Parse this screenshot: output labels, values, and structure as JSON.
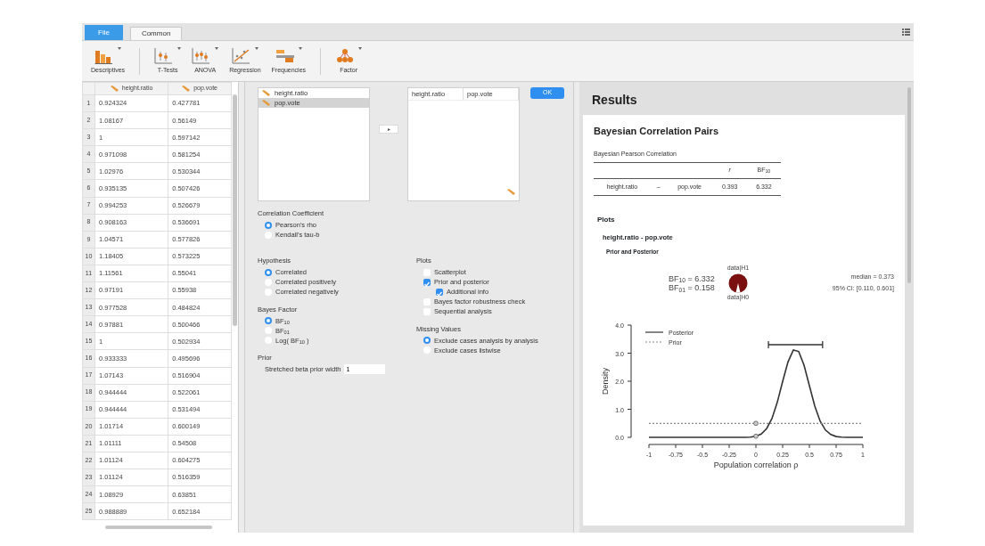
{
  "menu_tabs": [
    {
      "label": "File",
      "kind": "file",
      "selected": false
    },
    {
      "label": "Common",
      "kind": "tab",
      "selected": true
    }
  ],
  "toolbar": [
    {
      "label": "Descriptives",
      "kind": "bars"
    },
    {
      "label": "T-Tests",
      "kind": "ttest"
    },
    {
      "label": "ANOVA",
      "kind": "anova"
    },
    {
      "label": "Regression",
      "kind": "regression"
    },
    {
      "label": "Frequencies",
      "kind": "frequencies"
    },
    {
      "label": "Factor",
      "kind": "factor"
    }
  ],
  "data_table": {
    "columns": [
      "",
      "height.ratio",
      "pop.vote"
    ],
    "rows": [
      [
        "1",
        "0.924324",
        "0.427781"
      ],
      [
        "2",
        "1.08167",
        "0.56149"
      ],
      [
        "3",
        "1",
        "0.597142"
      ],
      [
        "4",
        "0.971098",
        "0.581254"
      ],
      [
        "5",
        "1.02976",
        "0.530344"
      ],
      [
        "6",
        "0.935135",
        "0.507426"
      ],
      [
        "7",
        "0.994253",
        "0.526679"
      ],
      [
        "8",
        "0.908163",
        "0.536691"
      ],
      [
        "9",
        "1.04571",
        "0.577826"
      ],
      [
        "10",
        "1.18405",
        "0.573225"
      ],
      [
        "11",
        "1.11561",
        "0.55041"
      ],
      [
        "12",
        "0.97191",
        "0.55938"
      ],
      [
        "13",
        "0.977528",
        "0.484824"
      ],
      [
        "14",
        "0.97881",
        "0.500466"
      ],
      [
        "15",
        "1",
        "0.502934"
      ],
      [
        "16",
        "0.933333",
        "0.495696"
      ],
      [
        "17",
        "1.07143",
        "0.516904"
      ],
      [
        "18",
        "0.944444",
        "0.522061"
      ],
      [
        "19",
        "0.944444",
        "0.531494"
      ],
      [
        "20",
        "1.01714",
        "0.600149"
      ],
      [
        "21",
        "1.01111",
        "0.54508"
      ],
      [
        "22",
        "1.01124",
        "0.604275"
      ],
      [
        "23",
        "1.01124",
        "0.516359"
      ],
      [
        "24",
        "1.08929",
        "0.63851"
      ],
      [
        "25",
        "0.988889",
        "0.652184"
      ]
    ]
  },
  "analysis": {
    "available_variables": [
      {
        "label": "height.ratio",
        "selected": false
      },
      {
        "label": "pop.vote",
        "selected": true
      }
    ],
    "move_button": "▸",
    "selected_variables": [
      "height.ratio",
      "pop.vote"
    ],
    "ok_button": "OK",
    "correlation_coefficient": {
      "title": "Correlation Coefficient",
      "kind": "radio",
      "options": [
        {
          "label": "Pearson's rho",
          "selected": true
        },
        {
          "label": "Kendall's tau-b",
          "selected": false
        }
      ]
    },
    "left_groups": [
      {
        "title": "Hypothesis",
        "kind": "radio",
        "options": [
          {
            "label": "Correlated",
            "selected": true
          },
          {
            "label": "Correlated positively",
            "selected": false
          },
          {
            "label": "Correlated negatively",
            "selected": false
          }
        ]
      },
      {
        "title": "Bayes Factor",
        "kind": "radio",
        "options": [
          {
            "label": "BF$_{10}$",
            "selected": true
          },
          {
            "label": "BF$_{01}$",
            "selected": false
          },
          {
            "label": "Log( BF$_{10}$ )",
            "selected": false
          }
        ]
      },
      {
        "title": "Prior",
        "kind": "field",
        "label": "Stretched beta prior width",
        "value": "1"
      }
    ],
    "right_groups": [
      {
        "title": "Plots",
        "kind": "checkbox",
        "options": [
          {
            "label": "Scatterplot",
            "checked": false
          },
          {
            "label": "Prior and posterior",
            "checked": true,
            "children": [
              {
                "label": "Additional info",
                "checked": true
              }
            ]
          },
          {
            "label": "Bayes factor robustness check",
            "checked": false
          },
          {
            "label": "Sequential analysis",
            "checked": false
          }
        ]
      },
      {
        "title": "Missing Values",
        "kind": "radio",
        "options": [
          {
            "label": "Exclude cases analysis by analysis",
            "selected": true
          },
          {
            "label": "Exclude cases listwise",
            "selected": false
          }
        ]
      }
    ]
  },
  "results": {
    "header": "Results",
    "title": "Bayesian Correlation Pairs",
    "table": {
      "caption": "Bayesian Pearson Correlation",
      "columns": [
        "",
        "",
        "",
        "r",
        "BF$_{10}$"
      ],
      "rows": [
        [
          "height.ratio",
          "–",
          "pop.vote",
          "0.393",
          "6.332"
        ]
      ]
    },
    "plots_heading": "Plots",
    "pair_heading": "height.ratio - pop.vote",
    "plot_title": "Prior and Posterior",
    "bf_lines": [
      "BF$_{10}$ = 6.332",
      "BF$_{01}$ = 0.158"
    ],
    "pie_labels": [
      "data|H1",
      "data|H0"
    ],
    "summary": [
      "median = 0.373",
      "95% CI: [0.110, 0.601]"
    ],
    "chart_data": {
      "type": "line",
      "xlabel": "Population correlation ρ",
      "ylabel": "Density",
      "x": [
        -1,
        -0.95,
        -0.9,
        -0.85,
        -0.8,
        -0.75,
        -0.7,
        -0.65,
        -0.6,
        -0.55,
        -0.5,
        -0.45,
        -0.4,
        -0.35,
        -0.3,
        -0.25,
        -0.2,
        -0.15,
        -0.1,
        -0.05,
        0,
        0.05,
        0.1,
        0.15,
        0.2,
        0.25,
        0.3,
        0.35,
        0.4,
        0.45,
        0.5,
        0.55,
        0.6,
        0.65,
        0.7,
        0.75,
        0.8,
        0.85,
        0.9,
        0.95,
        1
      ],
      "legend": true,
      "series": [
        {
          "name": "Posterior",
          "color": "#333333",
          "line_style": "solid",
          "values": [
            0,
            0,
            0,
            0,
            0,
            0,
            0,
            0,
            0,
            0,
            0,
            0,
            0,
            0,
            0,
            0,
            0,
            0,
            0,
            0.01,
            0.04,
            0.12,
            0.31,
            0.67,
            1.25,
            1.99,
            2.69,
            3.11,
            3.06,
            2.57,
            1.84,
            1.12,
            0.58,
            0.26,
            0.1,
            0.03,
            0.01,
            0,
            0,
            0,
            0
          ]
        },
        {
          "name": "Prior",
          "color": "#888888",
          "line_style": "dashed",
          "values": [
            0.5,
            0.5,
            0.5,
            0.5,
            0.5,
            0.5,
            0.5,
            0.5,
            0.5,
            0.5,
            0.5,
            0.5,
            0.5,
            0.5,
            0.5,
            0.5,
            0.5,
            0.5,
            0.5,
            0.5,
            0.5,
            0.5,
            0.5,
            0.5,
            0.5,
            0.5,
            0.5,
            0.5,
            0.5,
            0.5,
            0.5,
            0.5,
            0.5,
            0.5,
            0.5,
            0.5,
            0.5,
            0.5,
            0.5,
            0.5,
            0.5
          ]
        }
      ],
      "xlim": [
        -1,
        1
      ],
      "ylim": [
        0,
        4
      ],
      "xticks": [
        {
          "value": -1,
          "label": "-1"
        },
        {
          "value": -0.75,
          "label": "-0.75"
        },
        {
          "value": -0.5,
          "label": "-0.5"
        },
        {
          "value": -0.25,
          "label": "-0.25"
        },
        {
          "value": 0,
          "label": "0"
        },
        {
          "value": 0.25,
          "label": "0.25"
        },
        {
          "value": 0.5,
          "label": "0.5"
        },
        {
          "value": 0.75,
          "label": "0.75"
        },
        {
          "value": 1,
          "label": "1"
        }
      ],
      "yticks": [
        {
          "value": 0,
          "label": "0.0"
        },
        {
          "value": 1,
          "label": "1.0"
        },
        {
          "value": 2,
          "label": "2.0"
        },
        {
          "value": 3,
          "label": "3.0"
        },
        {
          "value": 4,
          "label": "4.0"
        }
      ]
    }
  }
}
